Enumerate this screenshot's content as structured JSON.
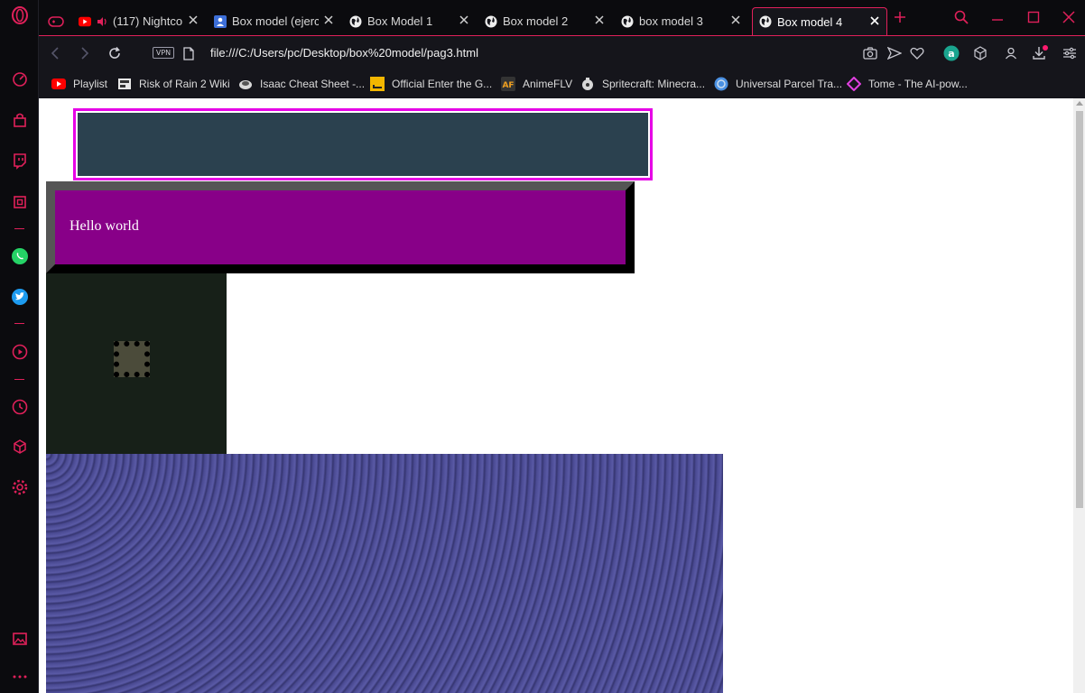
{
  "tabs": [
    {
      "title": "(117) Nightcor",
      "type": "youtube"
    },
    {
      "title": "Box model (ejercic",
      "type": "doc"
    },
    {
      "title": "Box Model 1",
      "type": "globe"
    },
    {
      "title": "Box model 2",
      "type": "globe"
    },
    {
      "title": "box model 3",
      "type": "globe"
    },
    {
      "title": "Box model 4",
      "type": "globe",
      "active": true
    }
  ],
  "address": {
    "vpn_label": "VPN",
    "url": "file:///C:/Users/pc/Desktop/box%20model/pag3.html"
  },
  "bookmarks": [
    {
      "label": "Playlist",
      "icon": "youtube-icon"
    },
    {
      "label": "Risk of Rain 2 Wiki",
      "icon": "wiki-icon"
    },
    {
      "label": "Isaac Cheat Sheet -...",
      "icon": "isaac-icon"
    },
    {
      "label": "Official Enter the G...",
      "icon": "gungeon-icon"
    },
    {
      "label": "AnimeFLV",
      "icon": "animeflv-icon"
    },
    {
      "label": "Spritecraft: Minecra...",
      "icon": "spritecraft-icon"
    },
    {
      "label": "Universal Parcel Tra...",
      "icon": "parcel-icon"
    },
    {
      "label": "Tome - The AI-pow...",
      "icon": "tome-icon"
    }
  ],
  "page": {
    "hello_text": "Hello world"
  },
  "colors": {
    "accent": "#e0205a",
    "box1_border": "#e600e6",
    "box1_fill": "#2b414f",
    "box2_fill": "#880088",
    "box3_fill": "#172018",
    "box4_fill": "#4a4a92"
  }
}
